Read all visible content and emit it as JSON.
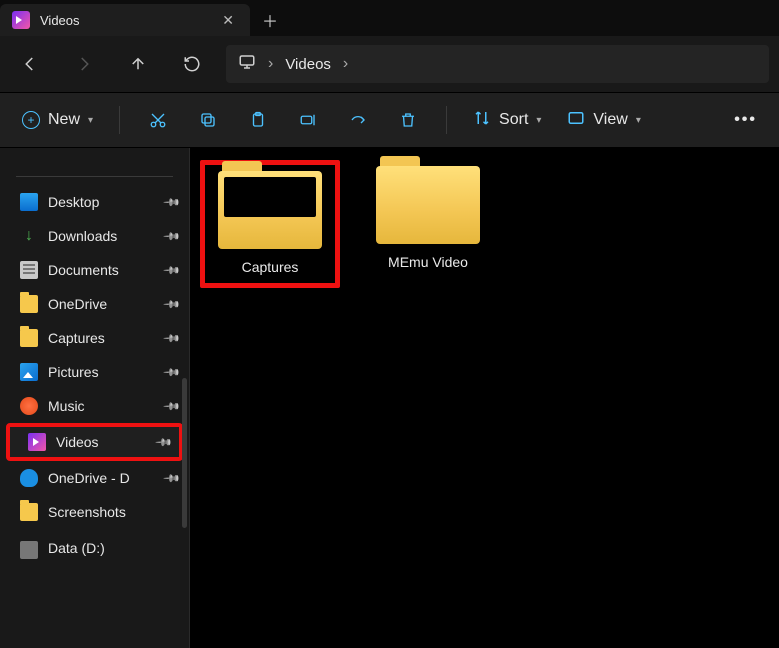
{
  "tab": {
    "title": "Videos"
  },
  "breadcrumb": {
    "current": "Videos"
  },
  "toolbar": {
    "new_label": "New",
    "sort_label": "Sort",
    "view_label": "View"
  },
  "sidebar": {
    "items": [
      {
        "label": "Desktop",
        "icon": "desktop",
        "pinned": true
      },
      {
        "label": "Downloads",
        "icon": "download",
        "pinned": true
      },
      {
        "label": "Documents",
        "icon": "doc",
        "pinned": true
      },
      {
        "label": "OneDrive",
        "icon": "folder",
        "pinned": true
      },
      {
        "label": "Captures",
        "icon": "folder",
        "pinned": true
      },
      {
        "label": "Pictures",
        "icon": "pic",
        "pinned": true
      },
      {
        "label": "Music",
        "icon": "music",
        "pinned": true
      },
      {
        "label": "Videos",
        "icon": "video",
        "pinned": true,
        "highlight": true
      },
      {
        "label": "OneDrive - D",
        "icon": "cloud",
        "pinned": true
      },
      {
        "label": "Screenshots",
        "icon": "folder",
        "pinned": false
      },
      {
        "label": "Data (D:)",
        "icon": "drive",
        "pinned": false
      }
    ]
  },
  "items": [
    {
      "label": "Captures",
      "kind": "folder-captures",
      "highlight": true
    },
    {
      "label": "MEmu Video",
      "kind": "folder",
      "highlight": false
    }
  ]
}
